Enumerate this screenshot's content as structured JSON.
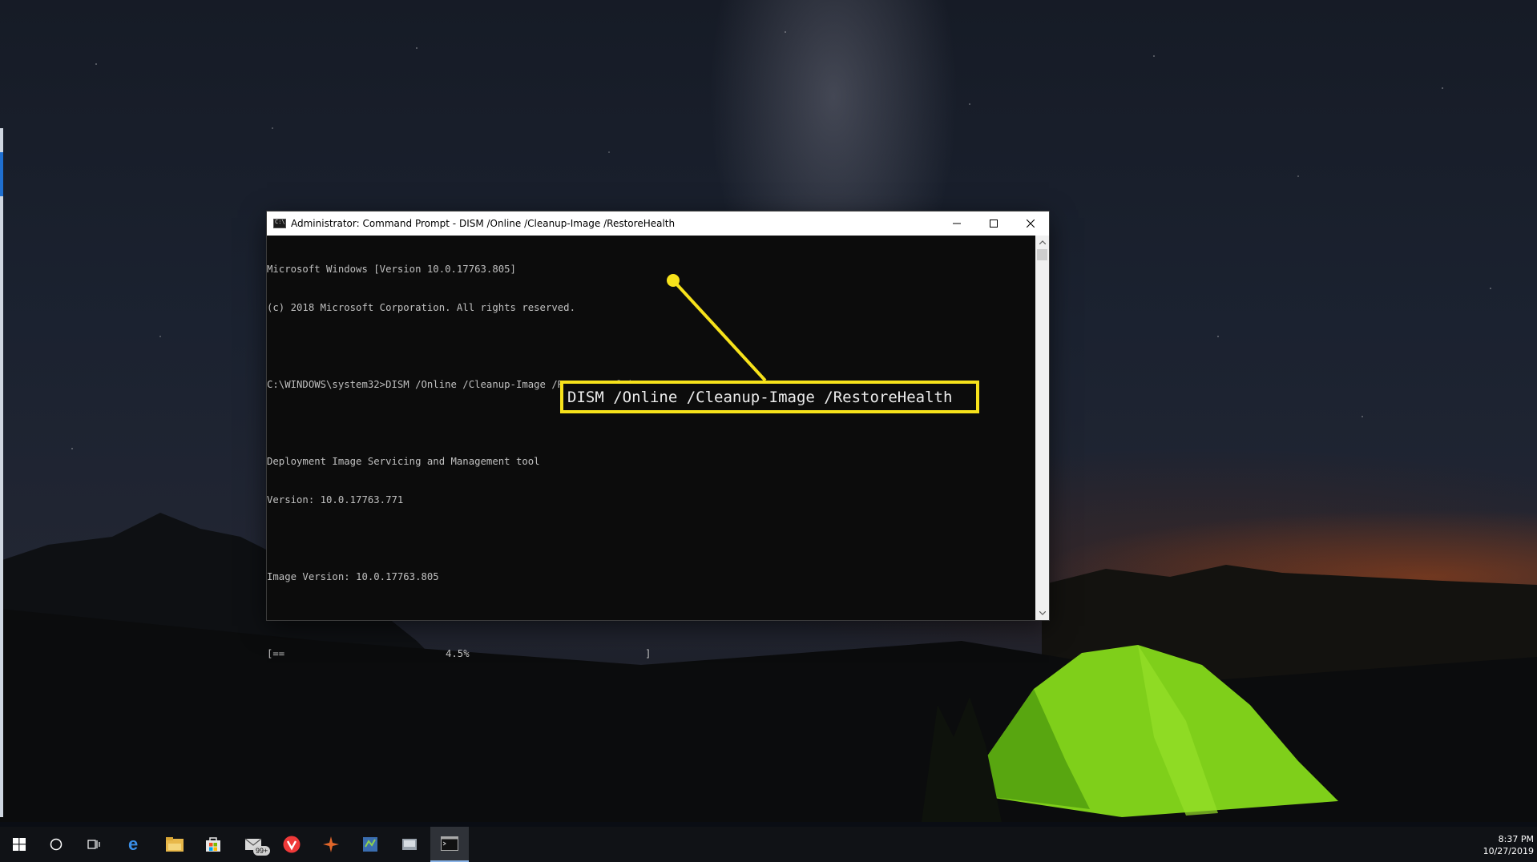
{
  "window": {
    "title": "Administrator: Command Prompt - DISM  /Online /Cleanup-Image /RestoreHealth",
    "controls": {
      "minimize": "minimize-icon",
      "maximize": "maximize-icon",
      "close": "close-icon"
    }
  },
  "console": {
    "lines": [
      "Microsoft Windows [Version 10.0.17763.805]",
      "(c) 2018 Microsoft Corporation. All rights reserved.",
      "",
      "C:\\WINDOWS\\system32>DISM /Online /Cleanup-Image /RestoreHealth",
      "",
      "Deployment Image Servicing and Management tool",
      "Version: 10.0.17763.771",
      "",
      "Image Version: 10.0.17763.805",
      ""
    ],
    "progress": {
      "open": "[==",
      "percent_text": "4.5%",
      "close": "]",
      "value": 4.5
    }
  },
  "callout": {
    "text": "DISM /Online /Cleanup-Image /RestoreHealth",
    "color": "#f7e21b"
  },
  "taskbar": {
    "items": [
      {
        "icon": "windows-start-icon",
        "active": false
      },
      {
        "icon": "cortana-search-icon",
        "active": false
      },
      {
        "icon": "task-view-icon",
        "active": false
      },
      {
        "icon": "edge-browser-icon",
        "active": false
      },
      {
        "icon": "file-explorer-icon",
        "active": false
      },
      {
        "icon": "store-icon",
        "active": false
      },
      {
        "icon": "mail-icon",
        "active": false,
        "badge": "99+"
      },
      {
        "icon": "vivaldi-icon",
        "active": false
      },
      {
        "icon": "app-icon",
        "active": false
      },
      {
        "icon": "app-icon-2",
        "active": false
      },
      {
        "icon": "app-icon-3",
        "active": false
      },
      {
        "icon": "command-prompt-icon",
        "active": true
      }
    ],
    "time": "8:37 PM",
    "date": "10/27/2019"
  },
  "colors": {
    "console_bg": "#0c0c0c",
    "console_text": "#c0c0c0",
    "accent": "#f7e21b",
    "taskbar_bg": "#101216"
  }
}
